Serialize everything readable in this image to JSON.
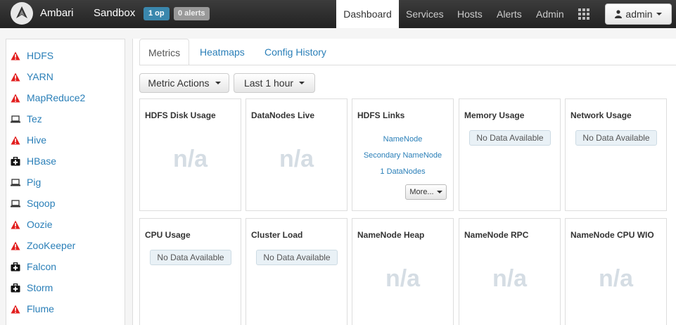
{
  "nav": {
    "brand": "Ambari",
    "cluster": "Sandbox",
    "ops_badge": "1 op",
    "alerts_badge": "0 alerts",
    "items": [
      {
        "label": "Dashboard",
        "active": true
      },
      {
        "label": "Services"
      },
      {
        "label": "Hosts"
      },
      {
        "label": "Alerts"
      },
      {
        "label": "Admin"
      }
    ],
    "user": "admin"
  },
  "sidebar": {
    "services": [
      {
        "name": "HDFS",
        "status": "alert"
      },
      {
        "name": "YARN",
        "status": "alert"
      },
      {
        "name": "MapReduce2",
        "status": "alert"
      },
      {
        "name": "Tez",
        "status": "client"
      },
      {
        "name": "Hive",
        "status": "alert"
      },
      {
        "name": "HBase",
        "status": "maintenance"
      },
      {
        "name": "Pig",
        "status": "client"
      },
      {
        "name": "Sqoop",
        "status": "client"
      },
      {
        "name": "Oozie",
        "status": "alert"
      },
      {
        "name": "ZooKeeper",
        "status": "alert"
      },
      {
        "name": "Falcon",
        "status": "maintenance"
      },
      {
        "name": "Storm",
        "status": "maintenance"
      },
      {
        "name": "Flume",
        "status": "alert"
      }
    ]
  },
  "tabs": [
    {
      "label": "Metrics",
      "active": true
    },
    {
      "label": "Heatmaps"
    },
    {
      "label": "Config History"
    }
  ],
  "toolbar": {
    "metric_actions": "Metric Actions",
    "time_range": "Last 1 hour"
  },
  "widgets": {
    "hdfs_disk_usage": {
      "title": "HDFS Disk Usage",
      "value": "n/a"
    },
    "datanodes_live": {
      "title": "DataNodes Live",
      "value": "n/a"
    },
    "hdfs_links": {
      "title": "HDFS Links",
      "links": [
        "NameNode",
        "Secondary NameNode",
        "1 DataNodes"
      ],
      "more": "More..."
    },
    "memory_usage": {
      "title": "Memory Usage",
      "value": "No Data Available"
    },
    "network_usage": {
      "title": "Network Usage",
      "value": "No Data Available"
    },
    "cpu_usage": {
      "title": "CPU Usage",
      "value": "No Data Available"
    },
    "cluster_load": {
      "title": "Cluster Load",
      "value": "No Data Available"
    },
    "namenode_heap": {
      "title": "NameNode Heap",
      "value": "n/a"
    },
    "namenode_rpc": {
      "title": "NameNode RPC",
      "value": "n/a"
    },
    "namenode_cpu_wio": {
      "title": "NameNode CPU WIO",
      "value": "n/a"
    }
  },
  "colors": {
    "alert": "#e21d1d",
    "link": "#2a7fb8",
    "ops_badge": "#3a87ad",
    "na_text": "#d5dde4"
  }
}
